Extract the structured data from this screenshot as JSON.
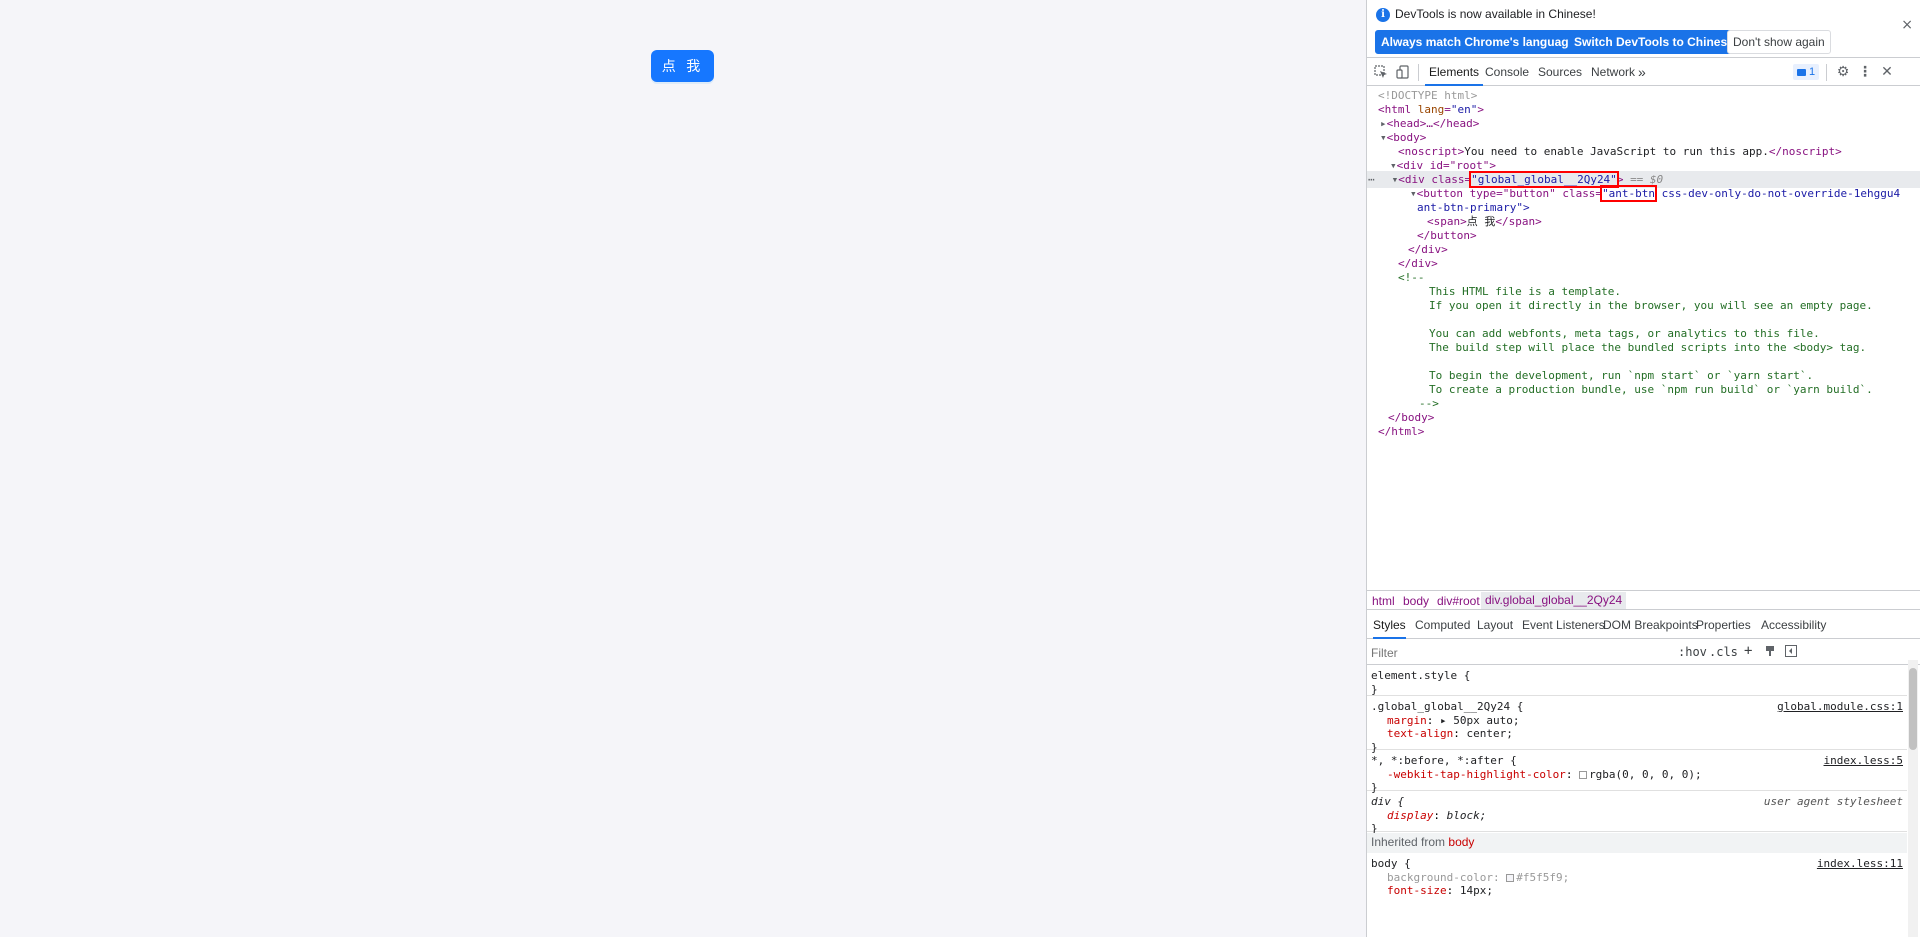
{
  "page": {
    "button_label": "点 我"
  },
  "devtools": {
    "banner": {
      "message": "DevTools is now available in Chinese!",
      "always_match": "Always match Chrome's language",
      "switch": "Switch DevTools to Chinese",
      "dont_show": "Don't show again",
      "close": "×"
    },
    "tabs": [
      "Elements",
      "Console",
      "Sources",
      "Network"
    ],
    "more_tabs": "»",
    "issues_count": "1",
    "dom": {
      "doctype": "<!DOCTYPE html>",
      "html_open_tag": "<html",
      "html_attr_name": "lang",
      "html_attr_value": "\"en\"",
      "head": "<head>…</head>",
      "body_open": "<body>",
      "noscript_open": "<noscript>",
      "noscript_text": "You need to enable JavaScript to run this app.",
      "noscript_close": "</noscript>",
      "root_div_open": "<div id=\"root\">",
      "global_div_prefix": "<div class=",
      "global_div_class": "\"global_global__2Qy24\"",
      "global_div_suffix": ">",
      "eq_sel": "== $0",
      "button_prefix": "<button type=\"button\" class=",
      "button_class_highlight": "\"ant-btn",
      "button_class_rest": " css-dev-only-do-not-override-1ehggu4",
      "button_class_line2": "ant-btn-primary\">",
      "span_open": "<span>",
      "span_text": "点 我",
      "span_close": "</span>",
      "button_close": "</button>",
      "div_close": "</div>",
      "comment_open": "<!--",
      "comment_lines": [
        "This HTML file is a template.",
        "If you open it directly in the browser, you will see an empty page.",
        "",
        "You can add webfonts, meta tags, or analytics to this file.",
        "The build step will place the bundled scripts into the <body> tag.",
        "",
        "To begin the development, run `npm start` or `yarn start`.",
        "To create a production bundle, use `npm run build` or `yarn build`."
      ],
      "comment_close": "-->",
      "body_close": "</body>",
      "html_close": "</html>"
    },
    "breadcrumb": [
      "html",
      "body",
      "div#root",
      "div.global_global__2Qy24"
    ],
    "sub_tabs": [
      "Styles",
      "Computed",
      "Layout",
      "Event Listeners",
      "DOM Breakpoints",
      "Properties",
      "Accessibility"
    ],
    "filter": {
      "placeholder": "Filter",
      "hov": ":hov",
      "cls": ".cls",
      "plus": "+"
    },
    "styles": {
      "element_style": "element.style {",
      "close_brace": "}",
      "rule1_selector": ".global_global__2Qy24 {",
      "rule1_source": "global.module.css:1",
      "rule1_props": [
        {
          "name": "margin",
          "value": "▸ 50px auto;"
        },
        {
          "name": "text-align",
          "value": "center;"
        }
      ],
      "rule2_selector": "*, *:before, *:after {",
      "rule2_source": "index.less:5",
      "rule2_prop_name": "-webkit-tap-highlight-color",
      "rule2_prop_value": "rgba(0, 0, 0, 0);",
      "rule3_selector": "div {",
      "rule3_source": "user agent stylesheet",
      "rule3_prop_name": "display",
      "rule3_prop_value": "block;",
      "inherited_label": "Inherited from",
      "inherited_from": "body",
      "rule4_selector": "body {",
      "rule4_source": "index.less:11",
      "rule4_props": [
        {
          "name": "background-color",
          "value": "#f5f5f9;"
        },
        {
          "name": "font-size",
          "value": "14px;"
        }
      ]
    }
  },
  "colors": {
    "page_bg": "#f5f5f9",
    "primary": "#1677ff",
    "devtools_blue": "#1a73e8",
    "highlight_red": "#ff0000"
  }
}
